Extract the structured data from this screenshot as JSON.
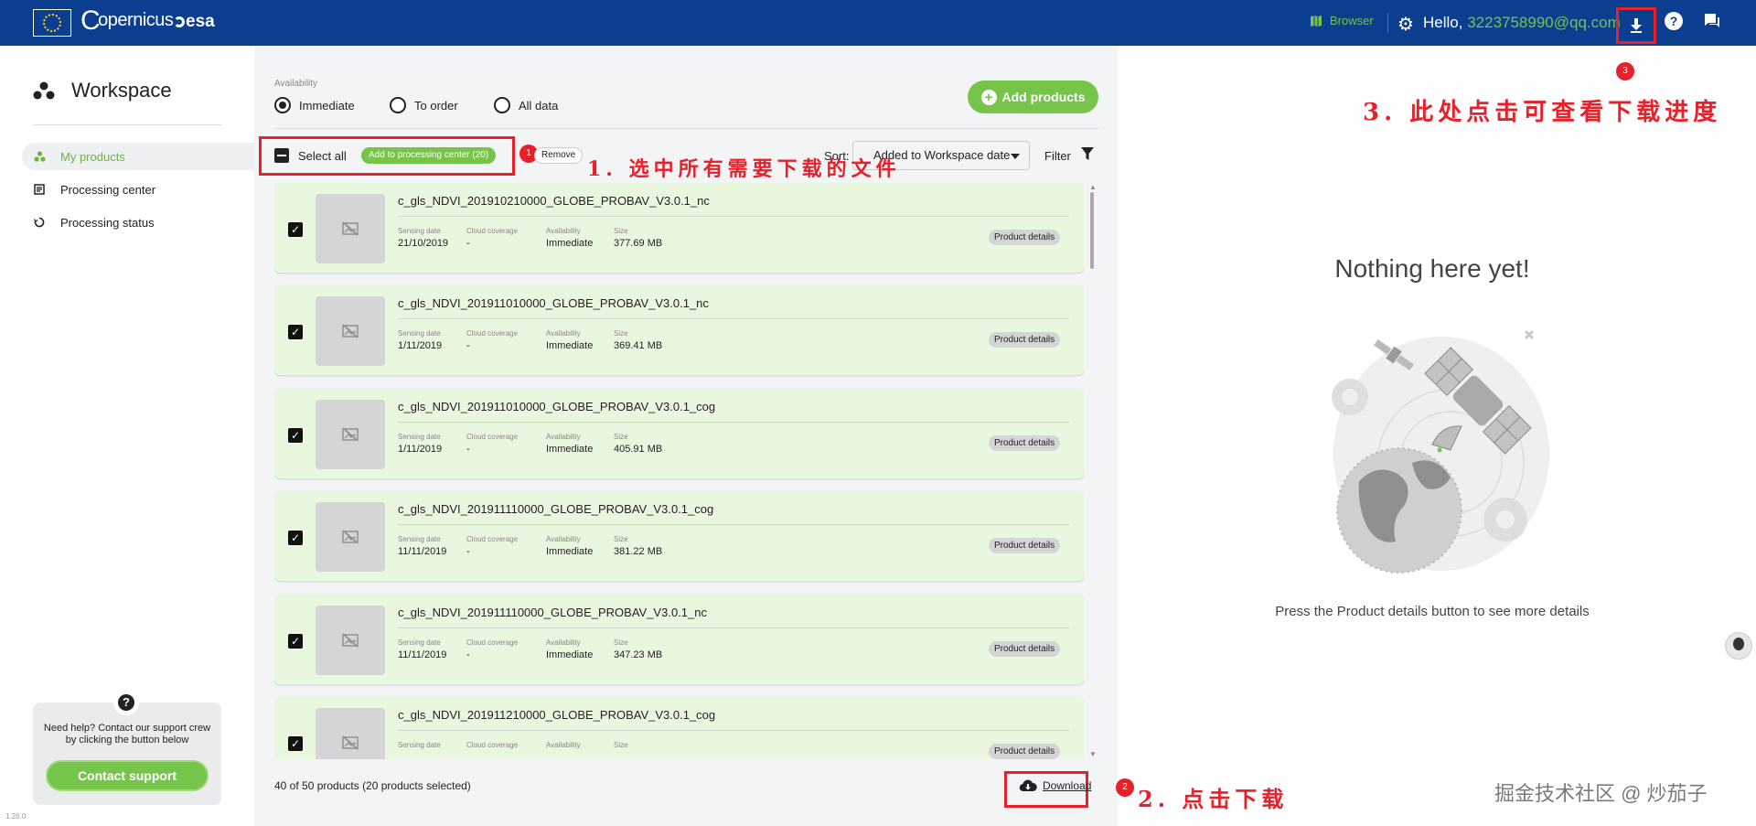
{
  "topbar": {
    "logo_eu": "EU",
    "logo_copernicus": "opernicus",
    "logo_esa": "esa",
    "browser_label": "Browser",
    "greeting": "Hello,",
    "user_email": "3223758990@qq.com"
  },
  "sidebar": {
    "title": "Workspace",
    "items": [
      {
        "label": "My products",
        "icon": "dots-icon",
        "active": true
      },
      {
        "label": "Processing center",
        "icon": "processing-icon",
        "active": false
      },
      {
        "label": "Processing status",
        "icon": "status-icon",
        "active": false
      }
    ],
    "help_text": "Need help? Contact our support crew by clicking the button below",
    "contact_label": "Contact support",
    "version": "1.26.0"
  },
  "main": {
    "availability_label": "Availability",
    "radios": [
      {
        "label": "Immediate",
        "selected": true
      },
      {
        "label": "To order",
        "selected": false
      },
      {
        "label": "All data",
        "selected": false
      }
    ],
    "add_products_label": "Add products",
    "select_all_label": "Select all",
    "add_processing_label": "Add to processing center (20)",
    "remove_label": "Remove",
    "sort_label": "Sort:",
    "sort_value": "Added to Workspace date",
    "filter_label": "Filter",
    "field_labels": {
      "sensing_date": "Sensing date",
      "cloud": "Cloud coverage",
      "availability": "Availability",
      "size": "Size"
    },
    "details_label": "Product details",
    "products": [
      {
        "name": "c_gls_NDVI_201910210000_GLOBE_PROBAV_V3.0.1_nc",
        "sensing_date": "21/10/2019",
        "cloud": "-",
        "availability": "Immediate",
        "size": "377.69 MB",
        "checked": true
      },
      {
        "name": "c_gls_NDVI_201911010000_GLOBE_PROBAV_V3.0.1_nc",
        "sensing_date": "1/11/2019",
        "cloud": "-",
        "availability": "Immediate",
        "size": "369.41 MB",
        "checked": true
      },
      {
        "name": "c_gls_NDVI_201911010000_GLOBE_PROBAV_V3.0.1_cog",
        "sensing_date": "1/11/2019",
        "cloud": "-",
        "availability": "Immediate",
        "size": "405.91 MB",
        "checked": true
      },
      {
        "name": "c_gls_NDVI_201911110000_GLOBE_PROBAV_V3.0.1_cog",
        "sensing_date": "11/11/2019",
        "cloud": "-",
        "availability": "Immediate",
        "size": "381.22 MB",
        "checked": true
      },
      {
        "name": "c_gls_NDVI_201911110000_GLOBE_PROBAV_V3.0.1_nc",
        "sensing_date": "11/11/2019",
        "cloud": "-",
        "availability": "Immediate",
        "size": "347.23 MB",
        "checked": true
      },
      {
        "name": "c_gls_NDVI_201911210000_GLOBE_PROBAV_V3.0.1_cog",
        "sensing_date": "",
        "cloud": "",
        "availability": "",
        "size": "",
        "checked": true
      }
    ],
    "count_text": "40 of 50 products (20 products selected)",
    "download_label": "Download"
  },
  "right": {
    "empty_title": "Nothing here yet!",
    "empty_sub": "Press the Product details button to see more details"
  },
  "annotations": {
    "badge1": "1",
    "badge2": "2",
    "badge3": "3",
    "note1": "1. 选中所有需要下载的文件",
    "note2": "2. 点击下载",
    "note3": "3. 此处点击可查看下载进度"
  },
  "watermark": "掘金技术社区 @ 炒茄子",
  "colors": {
    "topbar": "#0b3e8e",
    "accent_green": "#77c44a",
    "card_bg": "#eaf7df",
    "annotation_red": "#e8202a"
  }
}
